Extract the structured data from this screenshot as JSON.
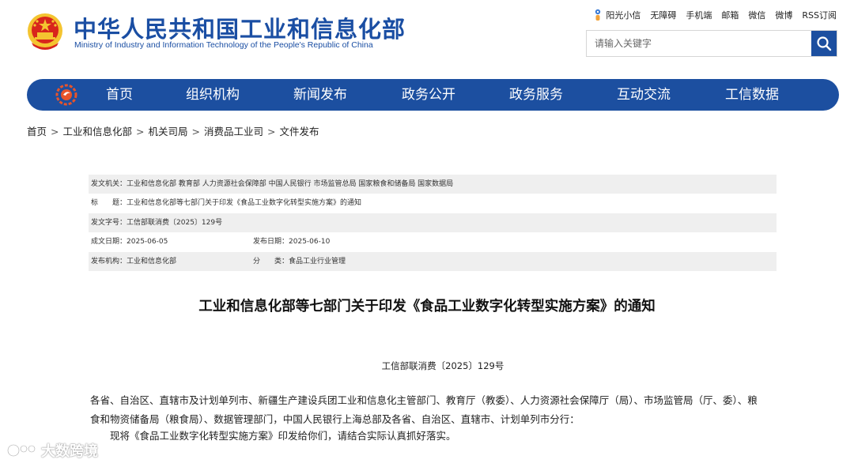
{
  "header": {
    "title": "中华人民共和国工业和信息化部",
    "subtitle": "Ministry of Industry and Information Technology of the People's Republic of China"
  },
  "top_links": [
    "阳光小信",
    "无障碍",
    "手机端",
    "邮箱",
    "微信",
    "微博",
    "RSS订阅"
  ],
  "search": {
    "placeholder": "请输入关键字"
  },
  "nav": [
    "首页",
    "组织机构",
    "新闻发布",
    "政务公开",
    "政务服务",
    "互动交流",
    "工信数据"
  ],
  "breadcrumb": [
    "首页",
    "工业和信息化部",
    "机关司局",
    "消费品工业司",
    "文件发布"
  ],
  "meta": {
    "issuer_label": "发文机关：",
    "issuer_value": "工业和信息化部 教育部 人力资源社会保障部 中国人民银行 市场监管总局 国家粮食和储备局 国家数据局",
    "title_label": "标　　题：",
    "title_value": "工业和信息化部等七部门关于印发《食品工业数字化转型实施方案》的通知",
    "docno_label": "发文字号：",
    "docno_value": "工信部联消费〔2025〕129号",
    "created_label": "成文日期：",
    "created_value": "2025-06-05",
    "published_label": "发布日期：",
    "published_value": "2025-06-10",
    "org_label": "发布机构：",
    "org_value": "工业和信息化部",
    "category_label": "分　　类：",
    "category_value": "食品工业行业管理"
  },
  "article": {
    "title": "工业和信息化部等七部门关于印发《食品工业数字化转型实施方案》的通知",
    "doc_number": "工信部联消费〔2025〕129号",
    "para1": "各省、自治区、直辖市及计划单列市、新疆生产建设兵团工业和信息化主管部门、教育厅（教委）、人力资源社会保障厅（局）、市场监管局（厅、委）、粮食和物资储备局（粮食局）、数据管理部门，中国人民银行上海总部及各省、自治区、直辖市、计划单列市分行：",
    "para2": "现将《食品工业数字化转型实施方案》印发给你们，请结合实际认真抓好落实。"
  },
  "watermark": {
    "text": "大数跨境"
  },
  "colors": {
    "brand_blue": "#1c4fa0",
    "emblem_red": "#d8251c",
    "emblem_gold": "#f4c430"
  }
}
